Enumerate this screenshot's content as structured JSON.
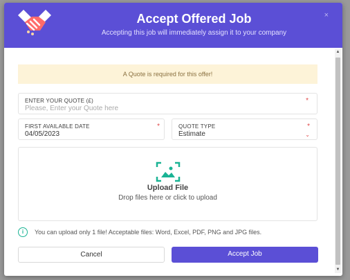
{
  "modal": {
    "title": "Accept Offered Job",
    "subtitle": "Accepting this job will immediately assign it to your company",
    "close_label": "×"
  },
  "alert": {
    "text": "A Quote is required for this offer!"
  },
  "quote": {
    "label": "ENTER YOUR QUOTE (£)",
    "placeholder": "Please, Enter your Quote here",
    "required_mark": "*"
  },
  "date": {
    "label": "FIRST AVAILABLE DATE",
    "value": "04/05/2023",
    "required_mark": "*"
  },
  "quote_type": {
    "label": "QUOTE TYPE",
    "value": "Estimate",
    "required_mark": "*",
    "chevron": "⌄"
  },
  "upload": {
    "title": "Upload File",
    "subtitle": "Drop files here or click to upload",
    "icon": "image-upload-icon"
  },
  "info": {
    "icon_glyph": "i",
    "text": "You can upload only 1 file! Acceptable files: Word, Excel, PDF, PNG and JPG files."
  },
  "buttons": {
    "cancel": "Cancel",
    "accept": "Accept Job"
  },
  "colors": {
    "primary": "#5b4fd6",
    "accent_teal": "#1ab394",
    "required": "#e04848",
    "alert_bg": "#fdf3d8"
  }
}
